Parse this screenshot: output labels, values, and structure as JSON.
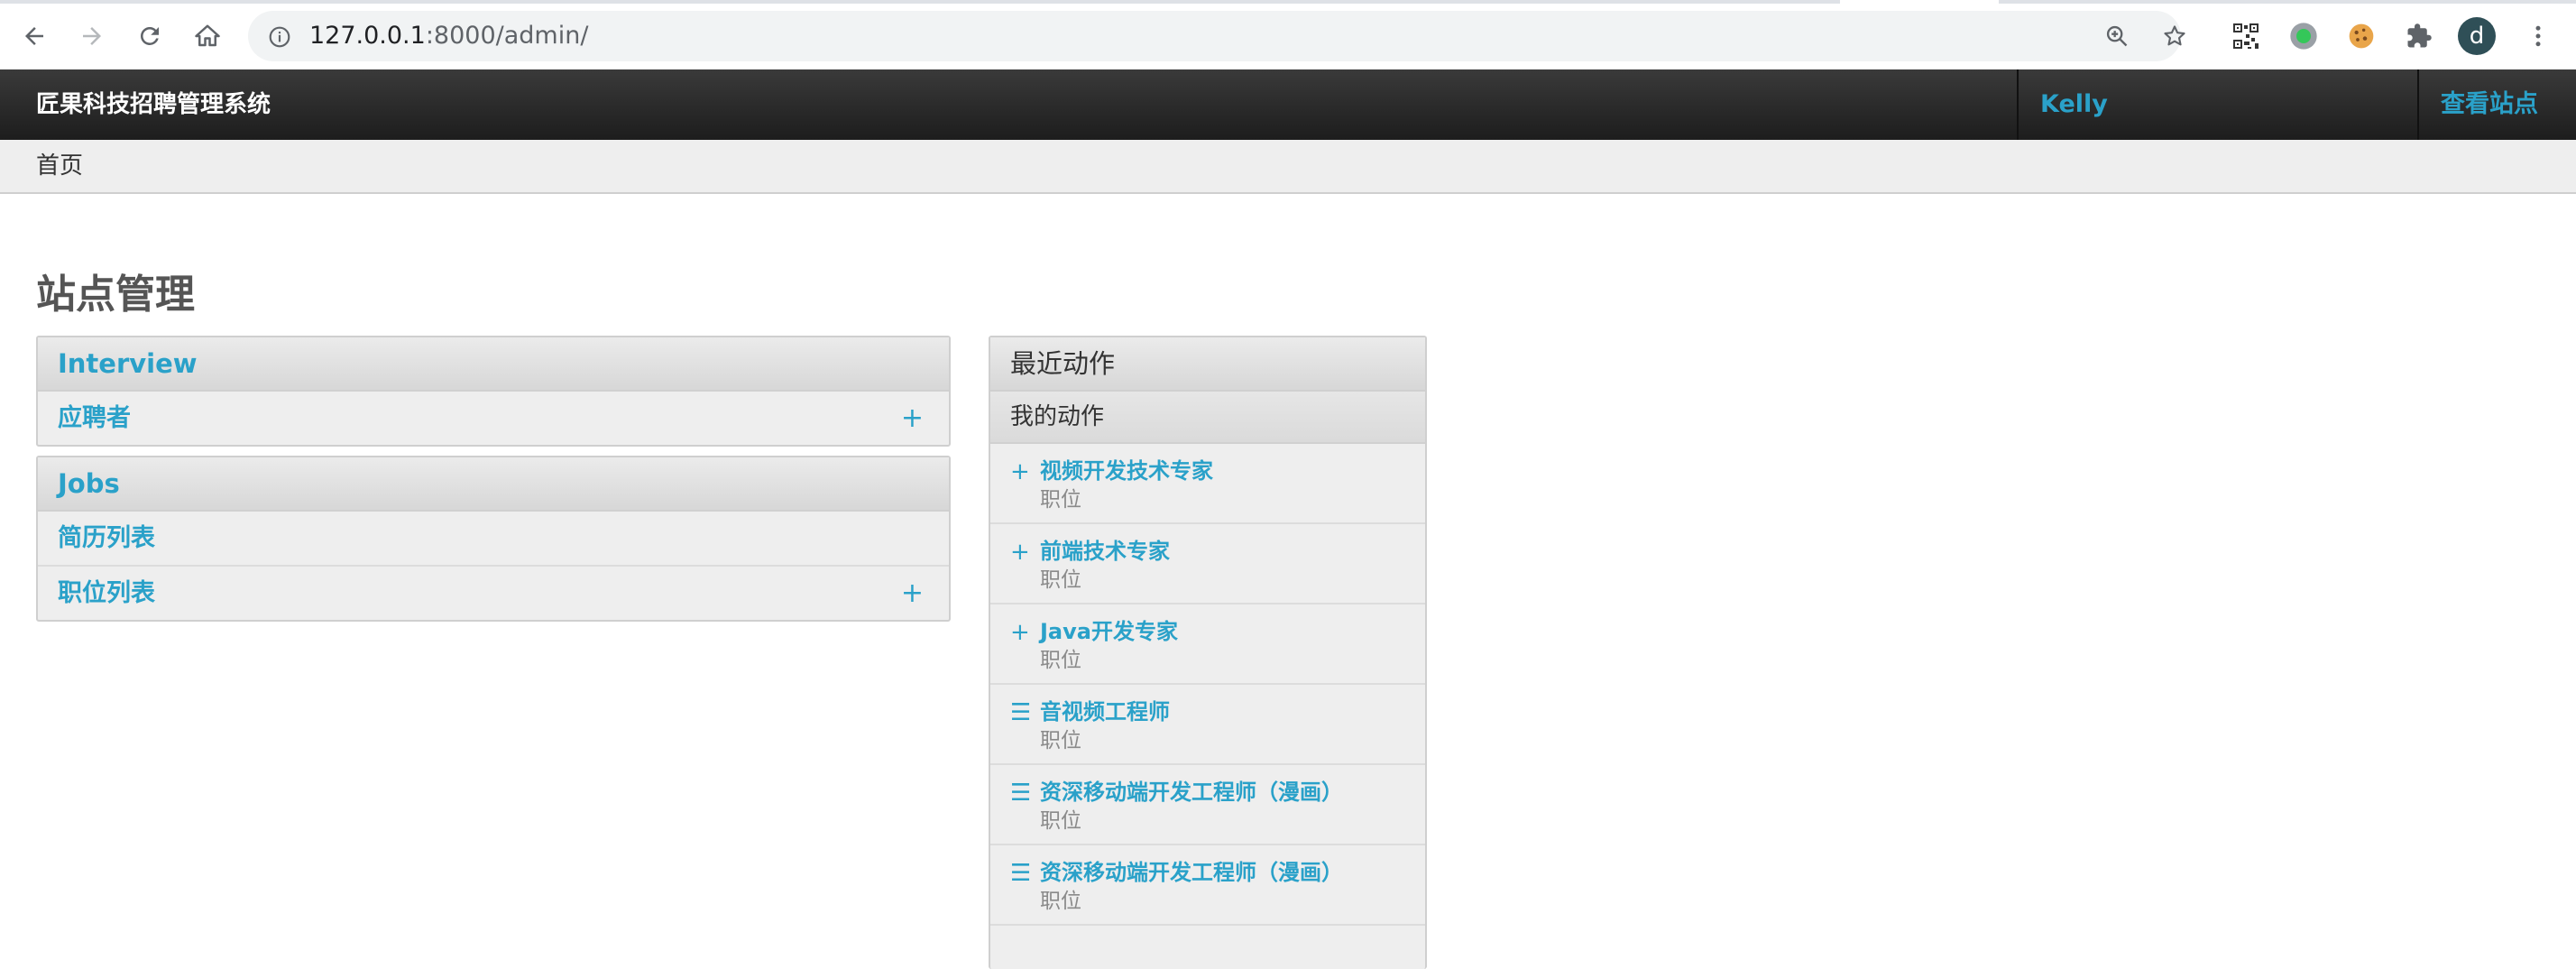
{
  "browser": {
    "url_host": "127.0.0.1",
    "url_rest": ":8000/admin/",
    "profile_initial": "d"
  },
  "header": {
    "branding": "匠果科技招聘管理系统",
    "user_name": "Kelly",
    "view_site": "查看站点"
  },
  "breadcrumbs": {
    "home": "首页"
  },
  "page_title": "站点管理",
  "modules": [
    {
      "caption": "Interview",
      "rows": [
        {
          "label": "应聘者",
          "add": "+"
        }
      ]
    },
    {
      "caption": "Jobs",
      "rows": [
        {
          "label": "简历列表",
          "add": ""
        },
        {
          "label": "职位列表",
          "add": "+"
        }
      ]
    }
  ],
  "recent_actions": {
    "caption": "最近动作",
    "subcaption": "我的动作",
    "items": [
      {
        "icon": "+",
        "icon_name": "add-icon",
        "title": "视频开发技术专家",
        "type": "职位"
      },
      {
        "icon": "+",
        "icon_name": "add-icon",
        "title": "前端技术专家",
        "type": "职位"
      },
      {
        "icon": "+",
        "icon_name": "add-icon",
        "title": "Java开发专家",
        "type": "职位"
      },
      {
        "icon": "☰",
        "icon_name": "change-icon",
        "title": "音视频工程师",
        "type": "职位"
      },
      {
        "icon": "☰",
        "icon_name": "change-icon",
        "title": "资深移动端开发工程师（漫画）",
        "type": "职位"
      },
      {
        "icon": "☰",
        "icon_name": "change-icon",
        "title": "资深移动端开发工程师（漫画）",
        "type": "职位"
      }
    ]
  },
  "colors": {
    "link": "#2aa1c9",
    "header_bg": "#2a2a2a",
    "module_bg": "#eeeeee"
  }
}
